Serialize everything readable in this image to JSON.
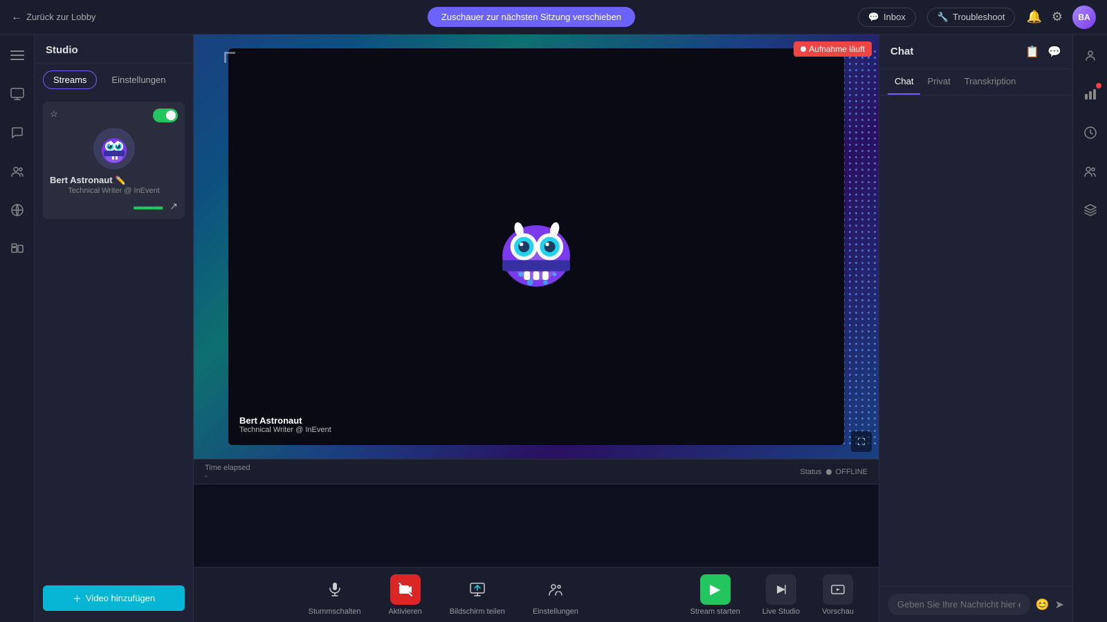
{
  "topbar": {
    "back_label": "Zurück zur Lobby",
    "center_btn": "Zuschauer zur nächsten Sitzung verschieben",
    "inbox_label": "Inbox",
    "troubleshoot_label": "Troubleshoot"
  },
  "studio": {
    "title": "Studio",
    "tabs": [
      {
        "id": "streams",
        "label": "Streams",
        "active": true
      },
      {
        "id": "einstellungen",
        "label": "Einstellungen",
        "active": false
      }
    ],
    "stream_card": {
      "name": "Bert Astronaut",
      "role": "Technical Writer @ InEvent",
      "edit_icon": "✏️"
    },
    "add_video_label": "Video hinzufügen"
  },
  "video": {
    "name": "Bert Astronaut",
    "role": "Technical Writer @ InEvent",
    "recording_label": "Aufnahme läuft",
    "time_elapsed_label": "Time elapsed",
    "time_value": "-",
    "status_label": "Status",
    "status_value": "OFFLINE"
  },
  "toolbar": {
    "buttons": [
      {
        "id": "mute",
        "icon": "🎙",
        "label": "Stummschalten",
        "style": "normal"
      },
      {
        "id": "video-off",
        "icon": "📷",
        "label": "Aktivieren",
        "style": "red"
      },
      {
        "id": "screen-share",
        "icon": "🖥",
        "label": "Bildschirm teilen",
        "style": "normal"
      },
      {
        "id": "settings",
        "icon": "👥",
        "label": "Einstellungen",
        "style": "normal"
      }
    ],
    "stream_start": "Stream starten",
    "live_studio": "Live Studio",
    "vorschau": "Vorschau"
  },
  "chat": {
    "title": "Chat",
    "tabs": [
      {
        "id": "chat",
        "label": "Chat",
        "active": true
      },
      {
        "id": "privat",
        "label": "Privat",
        "active": false
      },
      {
        "id": "transkription",
        "label": "Transkription",
        "active": false
      }
    ],
    "input_placeholder": "Geben Sie Ihre Nachricht hier ein"
  },
  "right_rail": {
    "icons": [
      {
        "id": "people",
        "symbol": "👤",
        "badge": false
      },
      {
        "id": "chart",
        "symbol": "📊",
        "badge": true
      },
      {
        "id": "clock",
        "symbol": "🕐",
        "badge": false
      },
      {
        "id": "group",
        "symbol": "👥",
        "badge": false
      },
      {
        "id": "layers",
        "symbol": "⚡",
        "badge": false
      }
    ]
  },
  "left_rail": {
    "icons": [
      {
        "id": "menu",
        "symbol": "☰"
      },
      {
        "id": "monitor",
        "symbol": "🖥"
      },
      {
        "id": "chat-bubble",
        "symbol": "💬"
      },
      {
        "id": "people",
        "symbol": "👥"
      },
      {
        "id": "globe",
        "symbol": "🌐"
      },
      {
        "id": "group2",
        "symbol": "👥"
      }
    ]
  }
}
